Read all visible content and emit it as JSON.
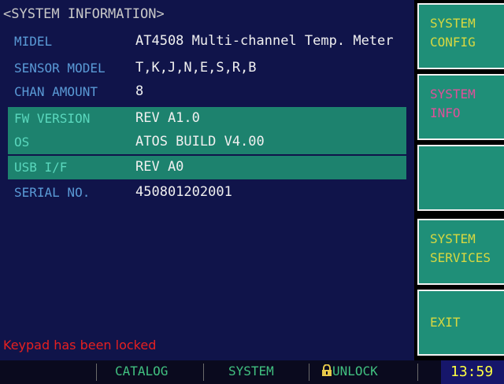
{
  "title": "<SYSTEM INFORMATION>",
  "info_rows": [
    {
      "label": "MIDEL",
      "value": "AT4508 Multi-channel Temp. Meter"
    },
    {
      "label": "SENSOR MODEL",
      "value": "T,K,J,N,E,S,R,B"
    },
    {
      "label": "CHAN AMOUNT",
      "value": "8"
    },
    {
      "label": "FW VERSION",
      "value": "REV A1.0"
    },
    {
      "label": "OS",
      "value": "ATOS BUILD V4.00"
    },
    {
      "label": "USB I/F",
      "value": "REV A0"
    },
    {
      "label": "SERIAL NO.",
      "value": "450801202001"
    }
  ],
  "status_message": "Keypad has been locked",
  "softkeys": [
    {
      "line1": "SYSTEM",
      "line2": "CONFIG"
    },
    {
      "line1": "SYSTEM",
      "line2": "INFO"
    },
    {
      "line1": "",
      "line2": ""
    },
    {
      "line1": "SYSTEM",
      "line2": "SERVICES"
    },
    {
      "line1": "EXIT",
      "line2": ""
    }
  ],
  "bottom_bar": {
    "catalog": "CATALOG",
    "system": "SYSTEM",
    "unlock": "UNLOCK",
    "time": "13:59"
  },
  "colors": {
    "panel_bg": "#10144a",
    "highlight_bg": "#1d826e",
    "softkey_bg": "#1f8f78",
    "softkey_text": "#d8d840",
    "softkey_active_text": "#e0509a",
    "label_text": "#5a9ad6",
    "warning_text": "#e62020",
    "bottom_text": "#41c080",
    "clock_text": "#ffff40"
  },
  "icons": {
    "unlock": "lock-icon"
  }
}
